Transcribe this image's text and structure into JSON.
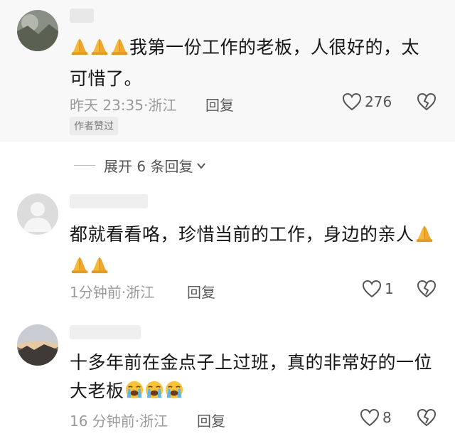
{
  "comments": [
    {
      "text_line1": "我第一份工作的老板，人很好的，太",
      "text_line2": "可惜了。",
      "time": "昨天 23:35",
      "location": "浙江",
      "reply_label": "回复",
      "likes": "276",
      "badge": "作者赞过"
    },
    {
      "text_line1": "都就看看咯，珍惜当前的工作，身边的亲人",
      "time": "1分钟前",
      "location": "浙江",
      "reply_label": "回复",
      "likes": "1"
    },
    {
      "text_line1": "十多年前在金点子上过班，真的非常好的一位",
      "text_line2": "大老板",
      "time": "16 分钟前",
      "location": "浙江",
      "reply_label": "回复",
      "likes": "8"
    }
  ],
  "expand_replies_label": "展开 6 条回复",
  "emoji_icons": [
    "folded-hands",
    "loudly-crying-face"
  ],
  "colors": {
    "background": "#ffffff",
    "thread_bg": "#f8f8f8",
    "meta_text": "#9a9a9a",
    "emoji_yellow": "#f6b83a"
  }
}
